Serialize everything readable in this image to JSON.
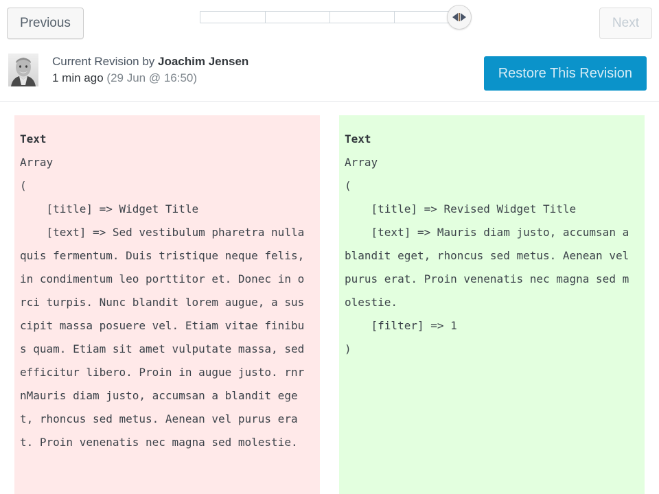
{
  "toolbar": {
    "previous_label": "Previous",
    "next_label": "Next",
    "slider": {
      "segments": 4,
      "handle_position_percent": 100,
      "handle_icon": "left-right-arrows-icon"
    }
  },
  "revision": {
    "heading_prefix": "Current Revision by ",
    "author": "Joachim Jensen",
    "relative_time": "1 min ago",
    "timestamp": "(29 Jun @ 16:50)",
    "avatar_alt": "user-avatar",
    "restore_label": "Restore This Revision"
  },
  "diff": {
    "left": {
      "field_label": "Text",
      "body": "Array\n(\n    [title] => Widget Title\n    [text] => Sed vestibulum pharetra nulla quis fermentum. Duis tristique neque felis, in condimentum leo porttitor et. Donec in orci turpis. Nunc blandit lorem augue, a suscipit massa posuere vel. Etiam vitae finibus quam. Etiam sit amet vulputate massa, sed efficitur libero. Proin in augue justo. rnrnMauris diam justo, accumsan a blandit eget, rhoncus sed metus. Aenean vel purus erat. Proin venenatis nec magna sed molestie."
    },
    "right": {
      "field_label": "Text",
      "body": "Array\n(\n    [title] => Revised Widget Title\n    [text] => Mauris diam justo, accumsan a blandit eget, rhoncus sed metus. Aenean vel purus erat. Proin venenatis nec magna sed molestie.\n    [filter] => 1\n)"
    }
  },
  "colors": {
    "removed_background": "#ffe9e9",
    "added_background": "#e3ffdf",
    "restore_button": "#0b93ca",
    "text": "#3c434a"
  }
}
